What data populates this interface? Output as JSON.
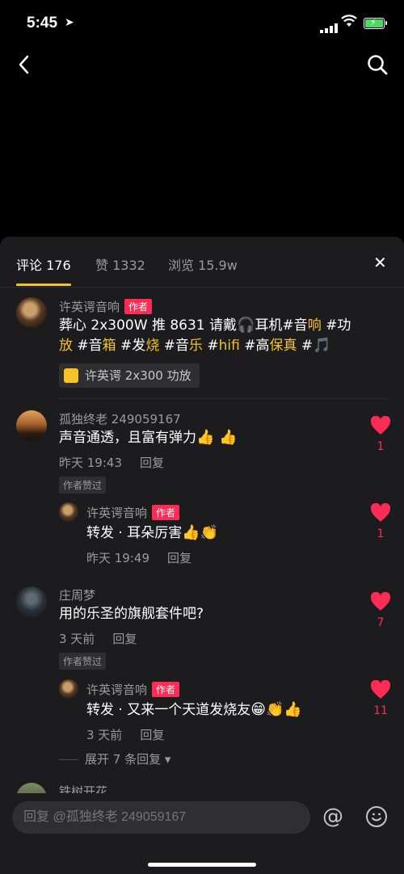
{
  "status_bar": {
    "time": "5:45",
    "location_arrow": "➤"
  },
  "icons": {
    "back": "back-chevron-icon",
    "search": "search-icon",
    "close": "close-icon",
    "heart": "heart-icon",
    "at": "at-icon",
    "emoji": "emoji-icon",
    "cart": "cart-icon"
  },
  "colors": {
    "accent": "#f6c224",
    "like": "#fe2c55",
    "sheet_bg": "#1c1c1e"
  },
  "tabs": [
    {
      "label": "评论 176",
      "active": true
    },
    {
      "label": "赞 1332",
      "active": false
    },
    {
      "label": "浏览 15.9w",
      "active": false
    }
  ],
  "close_label": "✕",
  "post": {
    "author": "许英谔音响",
    "author_tag": "作者",
    "text_line1_a": "葬心 2x300W 推 8631 请戴",
    "text_line1_emoji": "🎧",
    "text_line1_b": "耳机#音",
    "text_line1_c": "响",
    "text_line1_d": " #功",
    "text_line2_a": "放",
    "text_line2_b": " #音",
    "text_line2_c": "箱",
    "text_line2_d": " #发",
    "text_line2_e": "烧",
    "text_line2_f": " #音",
    "text_line2_g": "乐",
    "text_line2_h": " #",
    "text_line2_i": "hifi",
    "text_line2_j": " #高",
    "text_line2_k": "保真",
    "text_line2_l": " #",
    "text_line2_emoji": "🎵",
    "product": "许英谔 2x300 功放"
  },
  "comments": [
    {
      "user": "孤独终老 249059167",
      "text": "声音通透，且富有弹力",
      "emoji": "👍 👍",
      "time": "昨天 19:43",
      "reply": "回复",
      "badge": "作者赞过",
      "likes": "1",
      "sub": {
        "user": "许英谔音响",
        "tag": "作者",
        "text": "转发 · 耳朵厉害",
        "emoji": "👍👏",
        "time": "昨天 19:49",
        "reply": "回复",
        "likes": "1"
      }
    },
    {
      "user": "庄周梦",
      "text": "用的乐圣的旗舰套件吧?",
      "time": "3 天前",
      "reply": "回复",
      "badge": "作者赞过",
      "likes": "7",
      "sub": {
        "user": "许英谔音响",
        "tag": "作者",
        "text": "转发 · 又来一个天道发烧友",
        "emoji": "😁👏👍",
        "time": "3 天前",
        "reply": "回复",
        "likes": "11"
      },
      "expand": "展开 7 条回复"
    },
    {
      "user": "铁树开花"
    }
  ],
  "input": {
    "placeholder": "回复 @孤独终老 249059167",
    "at": "@"
  }
}
